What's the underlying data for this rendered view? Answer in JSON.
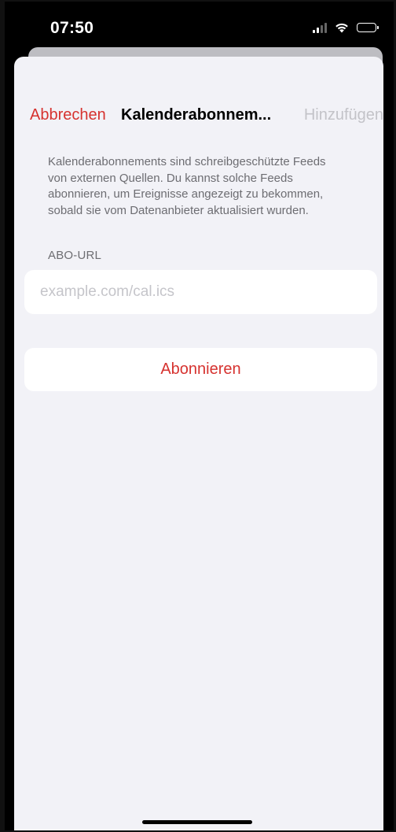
{
  "status_bar": {
    "time": "07:50",
    "icons": [
      "cellular-signal-icon",
      "wifi-icon",
      "battery-icon"
    ]
  },
  "nav": {
    "cancel_label": "Abbrechen",
    "title": "Kalenderabonnem...",
    "add_label": "Hinzufügen"
  },
  "description": "Kalenderabonnements sind schreibgeschützte Feeds von externen Quellen. Du kannst solche Feeds abonnieren, um Ereignisse angezeigt zu bekommen, sobald sie vom Datenanbieter aktualisiert wurden.",
  "url_section": {
    "label": "ABO-URL",
    "value": "",
    "placeholder": "example.com/cal.ics"
  },
  "subscribe_label": "Abonnieren",
  "colors": {
    "accent": "#d6322f",
    "background": "#f2f2f7",
    "secondary_text": "#6d6d72",
    "disabled_text": "#c3c3c8"
  }
}
